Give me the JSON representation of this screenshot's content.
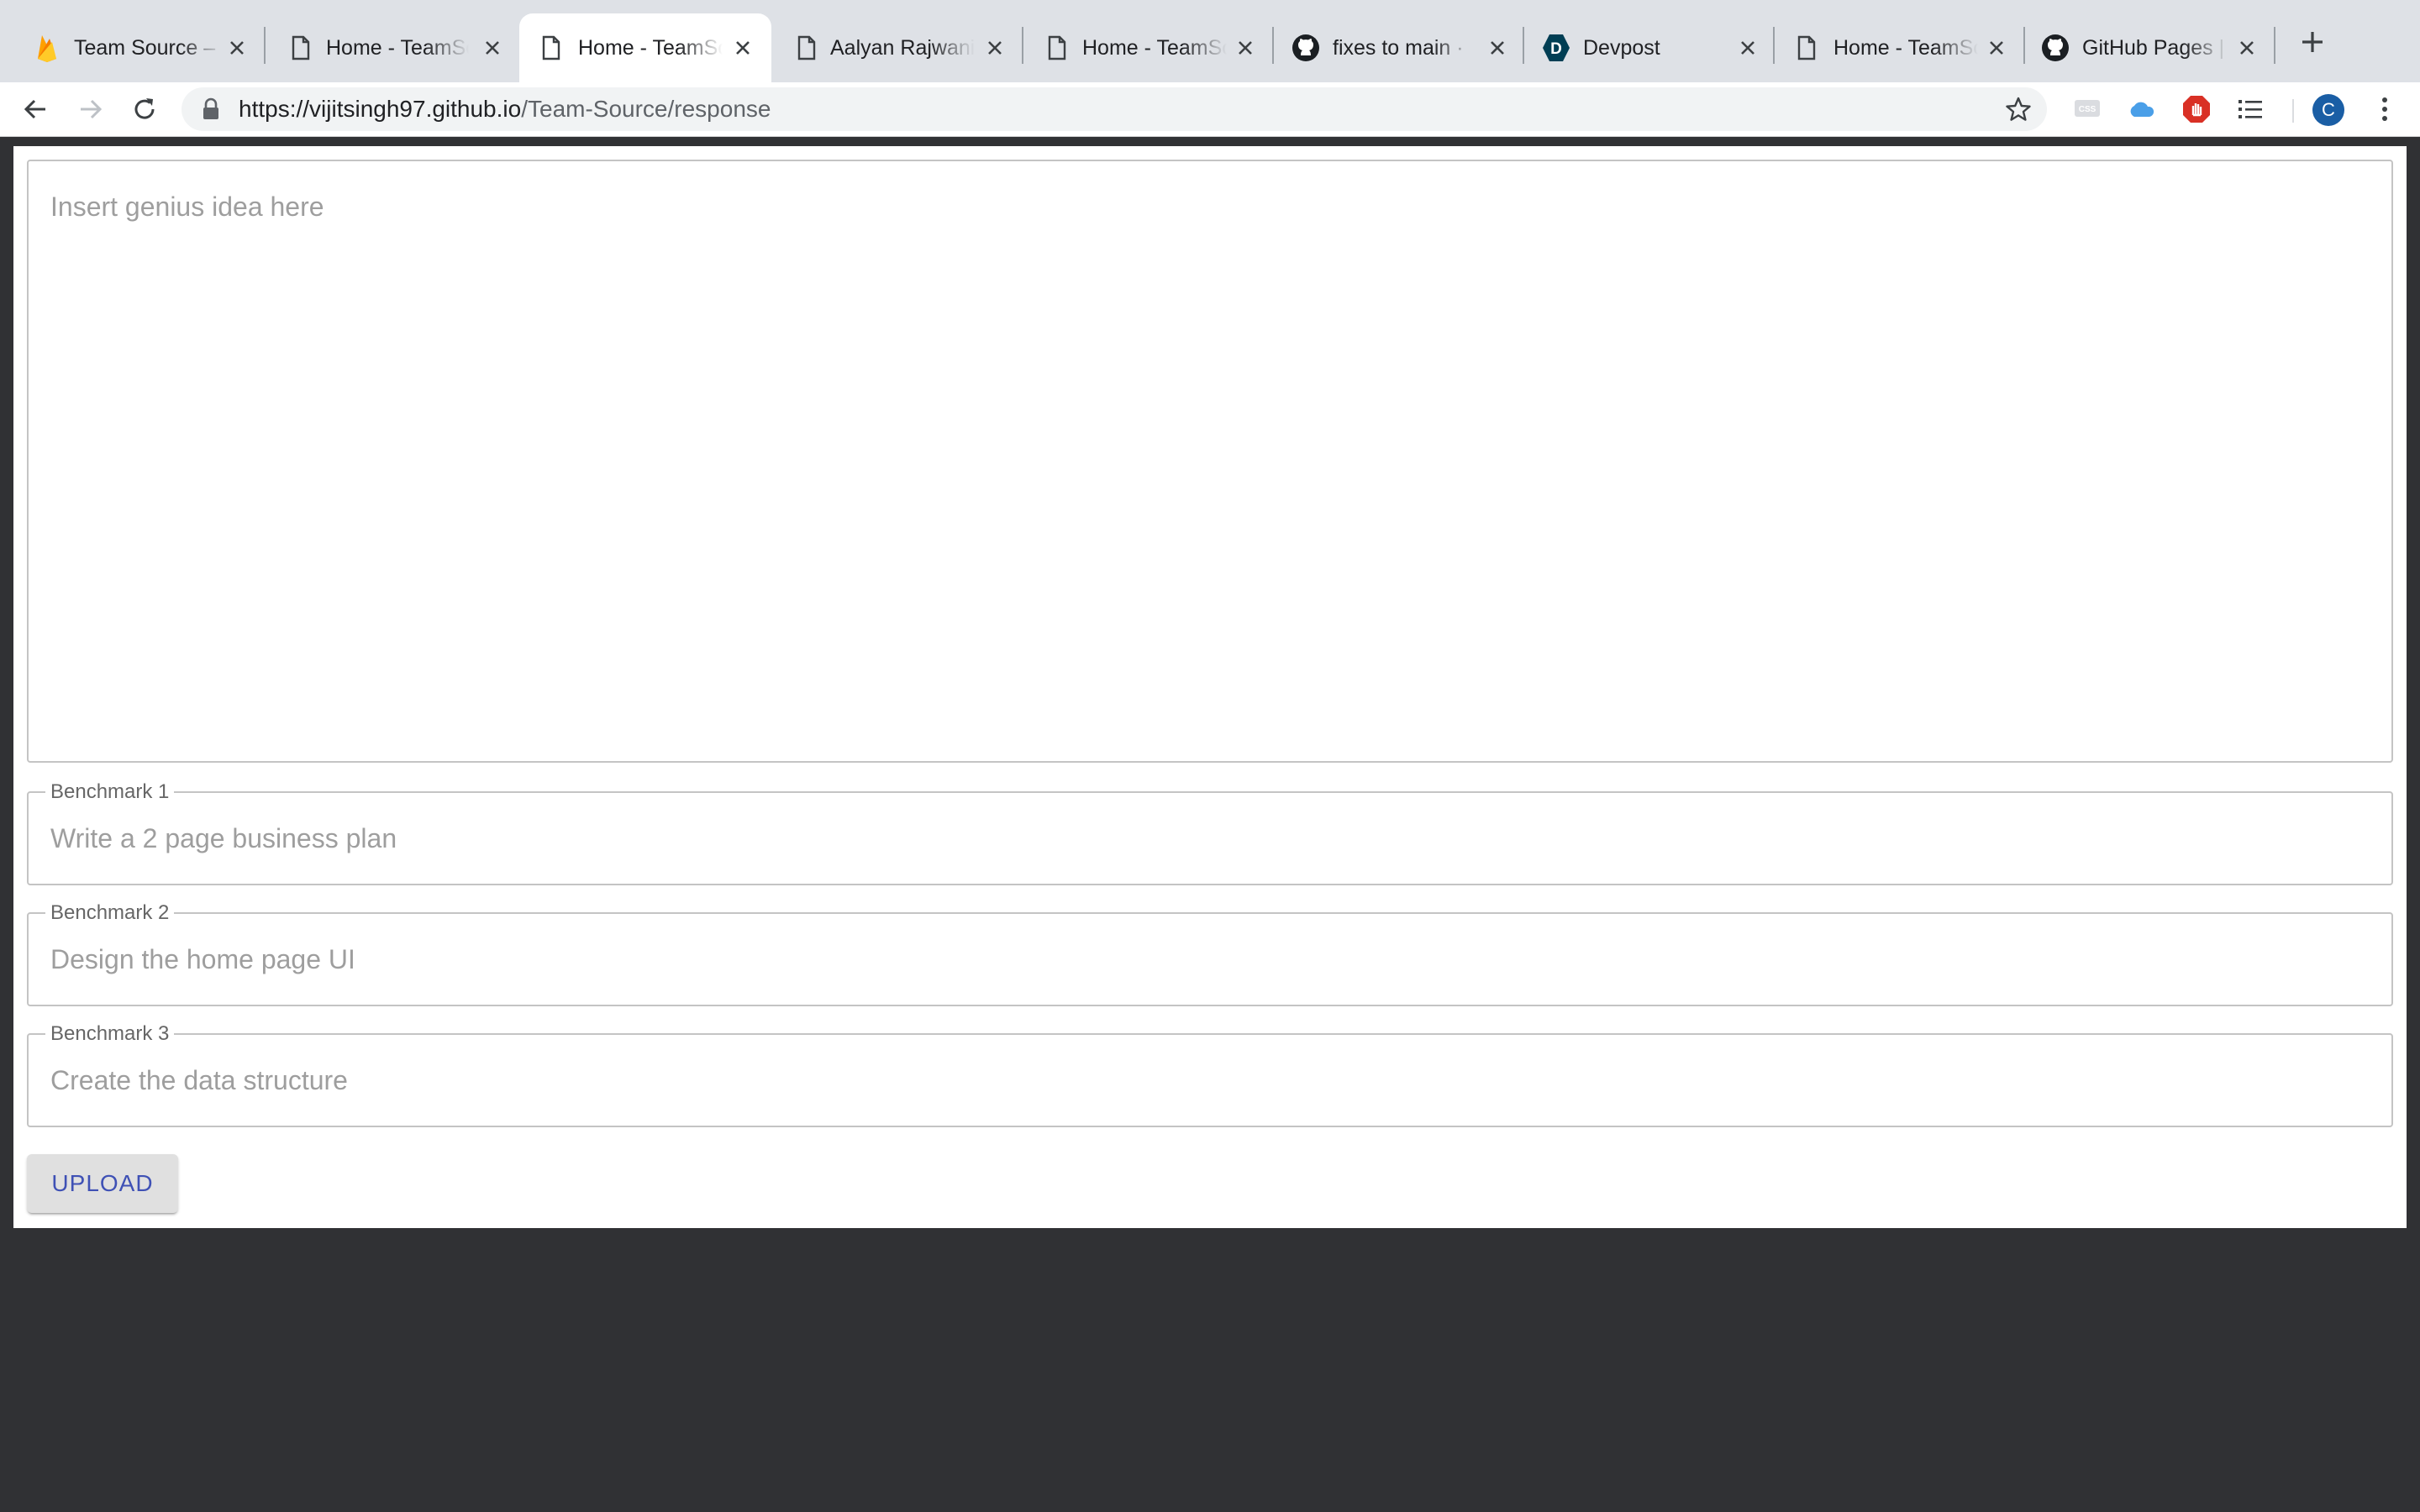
{
  "browser": {
    "tabs": [
      {
        "title": "Team Source –",
        "icon": "firebase-icon",
        "active": false
      },
      {
        "title": "Home - TeamSource",
        "icon": "page-icon",
        "active": false
      },
      {
        "title": "Home - TeamSource",
        "icon": "page-icon",
        "active": true
      },
      {
        "title": "Aalyan Rajwani",
        "icon": "page-icon",
        "active": false
      },
      {
        "title": "Home - TeamSource",
        "icon": "page-icon",
        "active": false
      },
      {
        "title": "fixes to main · ",
        "icon": "github-icon",
        "active": false
      },
      {
        "title": "Devpost",
        "icon": "devpost-icon",
        "active": false
      },
      {
        "title": "Home - TeamSource",
        "icon": "page-icon",
        "active": false
      },
      {
        "title": "GitHub Pages | ",
        "icon": "github-icon",
        "active": false
      }
    ],
    "url_domain": "https://vijitsingh97.github.io",
    "url_path": "/Team-Source/response",
    "avatar_letter": "C"
  },
  "form": {
    "idea_placeholder": "Insert genius idea here",
    "benchmarks": [
      {
        "label": "Benchmark 1",
        "placeholder": "Write a 2 page business plan"
      },
      {
        "label": "Benchmark 2",
        "placeholder": "Design the home page UI"
      },
      {
        "label": "Benchmark 3",
        "placeholder": "Create the data structure"
      }
    ],
    "upload_label": "UPLOAD"
  },
  "colors": {
    "accent": "#3f51b5",
    "background": "#303134",
    "tabstrip": "#dee1e6"
  }
}
